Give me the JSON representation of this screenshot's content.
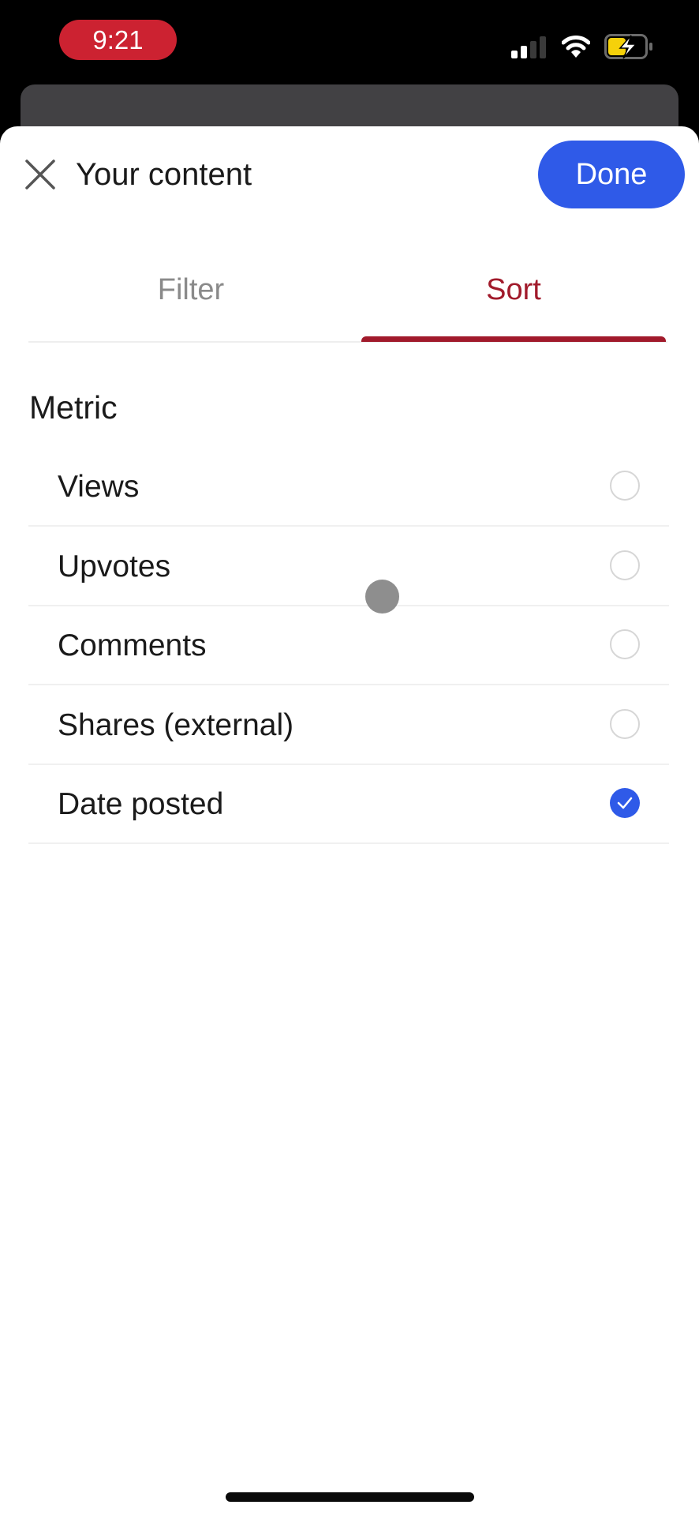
{
  "status_bar": {
    "time": "9:21",
    "time_pill_color": "#cc2231",
    "icons": [
      "signal-icon",
      "wifi-icon",
      "battery-charging-icon"
    ],
    "signal_bars_filled": 2,
    "signal_bars_total": 4,
    "battery_color": "#f5d10a"
  },
  "header": {
    "close_icon": "close-icon",
    "title": "Your content",
    "done_label": "Done",
    "done_color": "#2f5ae8"
  },
  "tabs": [
    {
      "label": "Filter",
      "active": false
    },
    {
      "label": "Sort",
      "active": true
    }
  ],
  "accent_color": "#a11a2b",
  "sort": {
    "section_title": "Metric",
    "options": [
      {
        "label": "Views",
        "selected": false
      },
      {
        "label": "Upvotes",
        "selected": false
      },
      {
        "label": "Comments",
        "selected": false
      },
      {
        "label": "Shares (external)",
        "selected": false
      },
      {
        "label": "Date posted",
        "selected": true
      }
    ]
  }
}
